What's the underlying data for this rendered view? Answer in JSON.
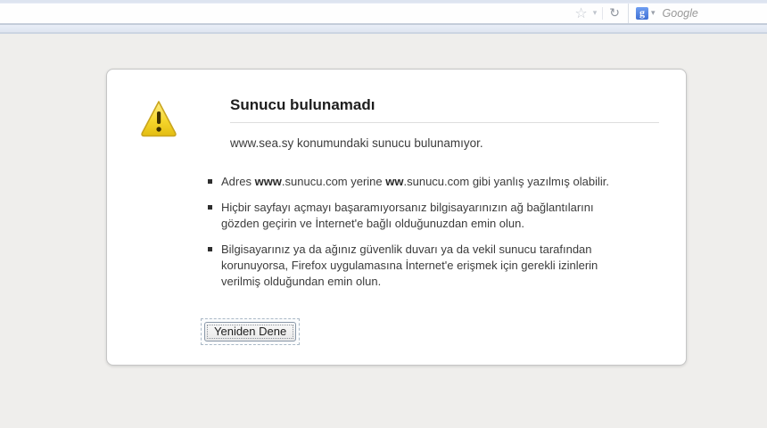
{
  "browser": {
    "address_bar": {
      "value": ""
    },
    "icons": {
      "bookmark_star": "☆",
      "dropdown_arrow": "▾",
      "reload": "↻",
      "search_dropdown_arrow": "▾"
    },
    "search": {
      "engine_logo_letter": "g",
      "placeholder": "Google"
    }
  },
  "error_page": {
    "title": "Sunucu bulunamadı",
    "description": "www.sea.sy konumundaki sunucu bulunamıyor.",
    "suggestions": {
      "s1_part1": "Adres ",
      "s1_bold1": "www",
      "s1_part2": ".sunucu.com yerine ",
      "s1_bold2": "ww",
      "s1_part3": ".sunucu.com gibi yanlış yazılmış olabilir.",
      "s2": "Hiçbir sayfayı açmayı başaramıyorsanız bilgisayarınızın ağ bağlantılarını gözden geçirin ve İnternet'e bağlı olduğunuzdan emin olun.",
      "s3": "Bilgisayarınız ya da ağınız güvenlik duvarı ya da vekil sunucu tarafından korunuyorsa, Firefox uygulamasına İnternet'e erişmek için gerekli izinlerin verilmiş olduğundan emin olun."
    },
    "retry_button": "Yeniden Dene"
  },
  "colors": {
    "page_background": "#efeeec",
    "card_background": "#ffffff",
    "toolbar_band": "#e3e9f3",
    "warning_yellow": "#f2ce21",
    "google_blue": "#4a7fe0"
  }
}
